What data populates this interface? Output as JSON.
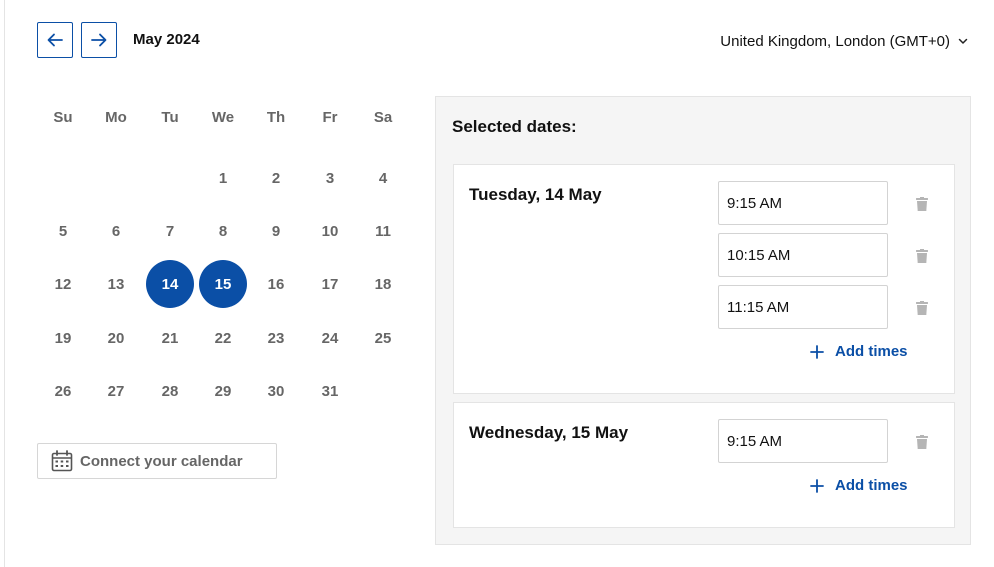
{
  "calendar": {
    "month_label": "May 2024",
    "weekdays": [
      "Su",
      "Mo",
      "Tu",
      "We",
      "Th",
      "Fr",
      "Sa"
    ],
    "weeks": [
      [
        "",
        "",
        "",
        "1",
        "2",
        "3",
        "4"
      ],
      [
        "5",
        "6",
        "7",
        "8",
        "9",
        "10",
        "11"
      ],
      [
        "12",
        "13",
        "14",
        "15",
        "16",
        "17",
        "18"
      ],
      [
        "19",
        "20",
        "21",
        "22",
        "23",
        "24",
        "25"
      ],
      [
        "26",
        "27",
        "28",
        "29",
        "30",
        "31",
        ""
      ]
    ],
    "selected_days": [
      "14",
      "15"
    ]
  },
  "timezone": {
    "label": "United Kingdom, London (GMT+0)"
  },
  "connect_calendar": {
    "label": "Connect your calendar"
  },
  "selected_dates": {
    "title": "Selected dates:",
    "groups": [
      {
        "date_label": "Tuesday, 14 May",
        "times": [
          "9:15 AM",
          "10:15 AM",
          "11:15 AM"
        ],
        "add_label": "Add times"
      },
      {
        "date_label": "Wednesday, 15 May",
        "times": [
          "9:15 AM"
        ],
        "add_label": "Add times"
      }
    ]
  },
  "colors": {
    "accent": "#0b4fa6",
    "muted_text": "#666666",
    "panel_bg": "#f5f5f5",
    "trash_icon": "#b5b5b5"
  }
}
